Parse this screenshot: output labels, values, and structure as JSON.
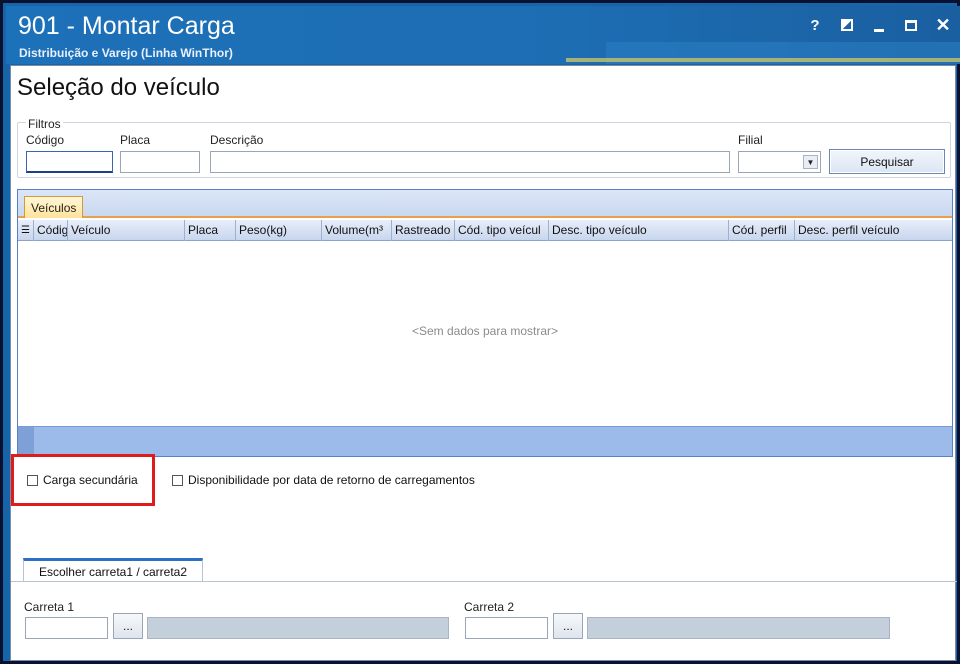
{
  "window": {
    "title": "901 - Montar Carga",
    "subtitle": "Distribuição e Varejo (Linha WinThor)",
    "help_label": "?",
    "close_label": "✕"
  },
  "page_title": "Seleção do veículo",
  "filters": {
    "legend": "Filtros",
    "codigo_label": "Código",
    "codigo_value": "",
    "placa_label": "Placa",
    "placa_value": "",
    "descricao_label": "Descrição",
    "descricao_value": "",
    "filial_label": "Filial",
    "filial_value": "",
    "search_button": "Pesquisar"
  },
  "grid": {
    "tab_label": "Veículos",
    "columns": [
      "Códig",
      "Veículo",
      "Placa",
      "Peso(kg)",
      "Volume(m³",
      "Rastreado",
      "Cód. tipo veícul",
      "Desc. tipo veículo",
      "Cód. perfil",
      "Desc. perfil veículo"
    ],
    "empty_text": "<Sem dados para mostrar>"
  },
  "options": {
    "carga_secundaria": "Carga secundária",
    "carga_secundaria_checked": false,
    "disponibilidade": "Disponibilidade por data de retorno de carregamentos",
    "disponibilidade_checked": false
  },
  "carreta_tab": {
    "label": "Escolher carreta1 / carreta2",
    "carreta1_label": "Carreta 1",
    "carreta1_value": "",
    "carreta2_label": "Carreta 2",
    "carreta2_value": "",
    "ellipsis": "..."
  },
  "colors": {
    "titlebar": "#1d71b8",
    "highlight": "#e01b1b",
    "grid_tab": "#ffe39a",
    "grid_footer": "#9cbbea"
  }
}
